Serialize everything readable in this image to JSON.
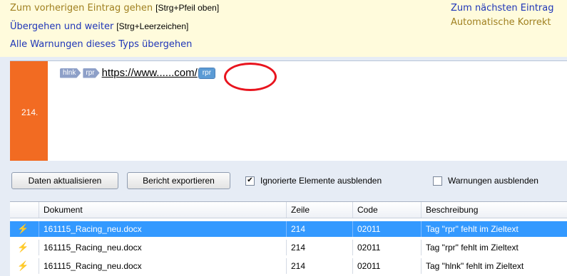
{
  "actions": {
    "prev_entry": "Zum vorherigen Eintrag gehen",
    "prev_entry_shortcut": "[Strg+Pfeil oben]",
    "skip_continue": "Übergehen und weiter",
    "skip_continue_shortcut": "[Strg+Leerzeichen]",
    "skip_all_type": "Alle Warnungen dieses Typs übergehen",
    "next_entry": "Zum nächsten Eintrag",
    "auto_correct": "Automatische Korrekt"
  },
  "segment": {
    "number": "214.",
    "tag_hlnk": "hlnk",
    "tag_rpr_open": "rpr",
    "url": "https://www......com/",
    "tag_rpr_selected": "rpr"
  },
  "toolbar": {
    "refresh_label": "Daten aktualisieren",
    "export_label": "Bericht exportieren",
    "hide_ignored_label": "Ignorierte Elemente ausblenden",
    "hide_ignored_checked": true,
    "hide_warnings_label": "Warnungen ausblenden",
    "hide_warnings_checked": false
  },
  "table": {
    "columns": [
      "Dokument",
      "Zeile",
      "Code",
      "Beschreibung"
    ],
    "rows": [
      {
        "doc": "161115_Racing_neu.docx",
        "line": "214",
        "code": "02011",
        "desc": "Tag \"rpr\" fehlt im Zieltext",
        "selected": true
      },
      {
        "doc": "161115_Racing_neu.docx",
        "line": "214",
        "code": "02011",
        "desc": "Tag \"rpr\" fehlt im Zieltext",
        "selected": false
      },
      {
        "doc": "161115_Racing_neu.docx",
        "line": "214",
        "code": "02011",
        "desc": "Tag \"hlnk\" fehlt im Zieltext",
        "selected": false
      }
    ]
  },
  "icons": {
    "row_icon": "warning-bolt-icon",
    "annotation": "red-circle-annotation"
  },
  "colors": {
    "segment_bar": "#f26b22",
    "selection": "#3399ff",
    "action_olive": "#a08020",
    "action_blue": "#1f36b8",
    "annotation_red": "#e8141e"
  }
}
